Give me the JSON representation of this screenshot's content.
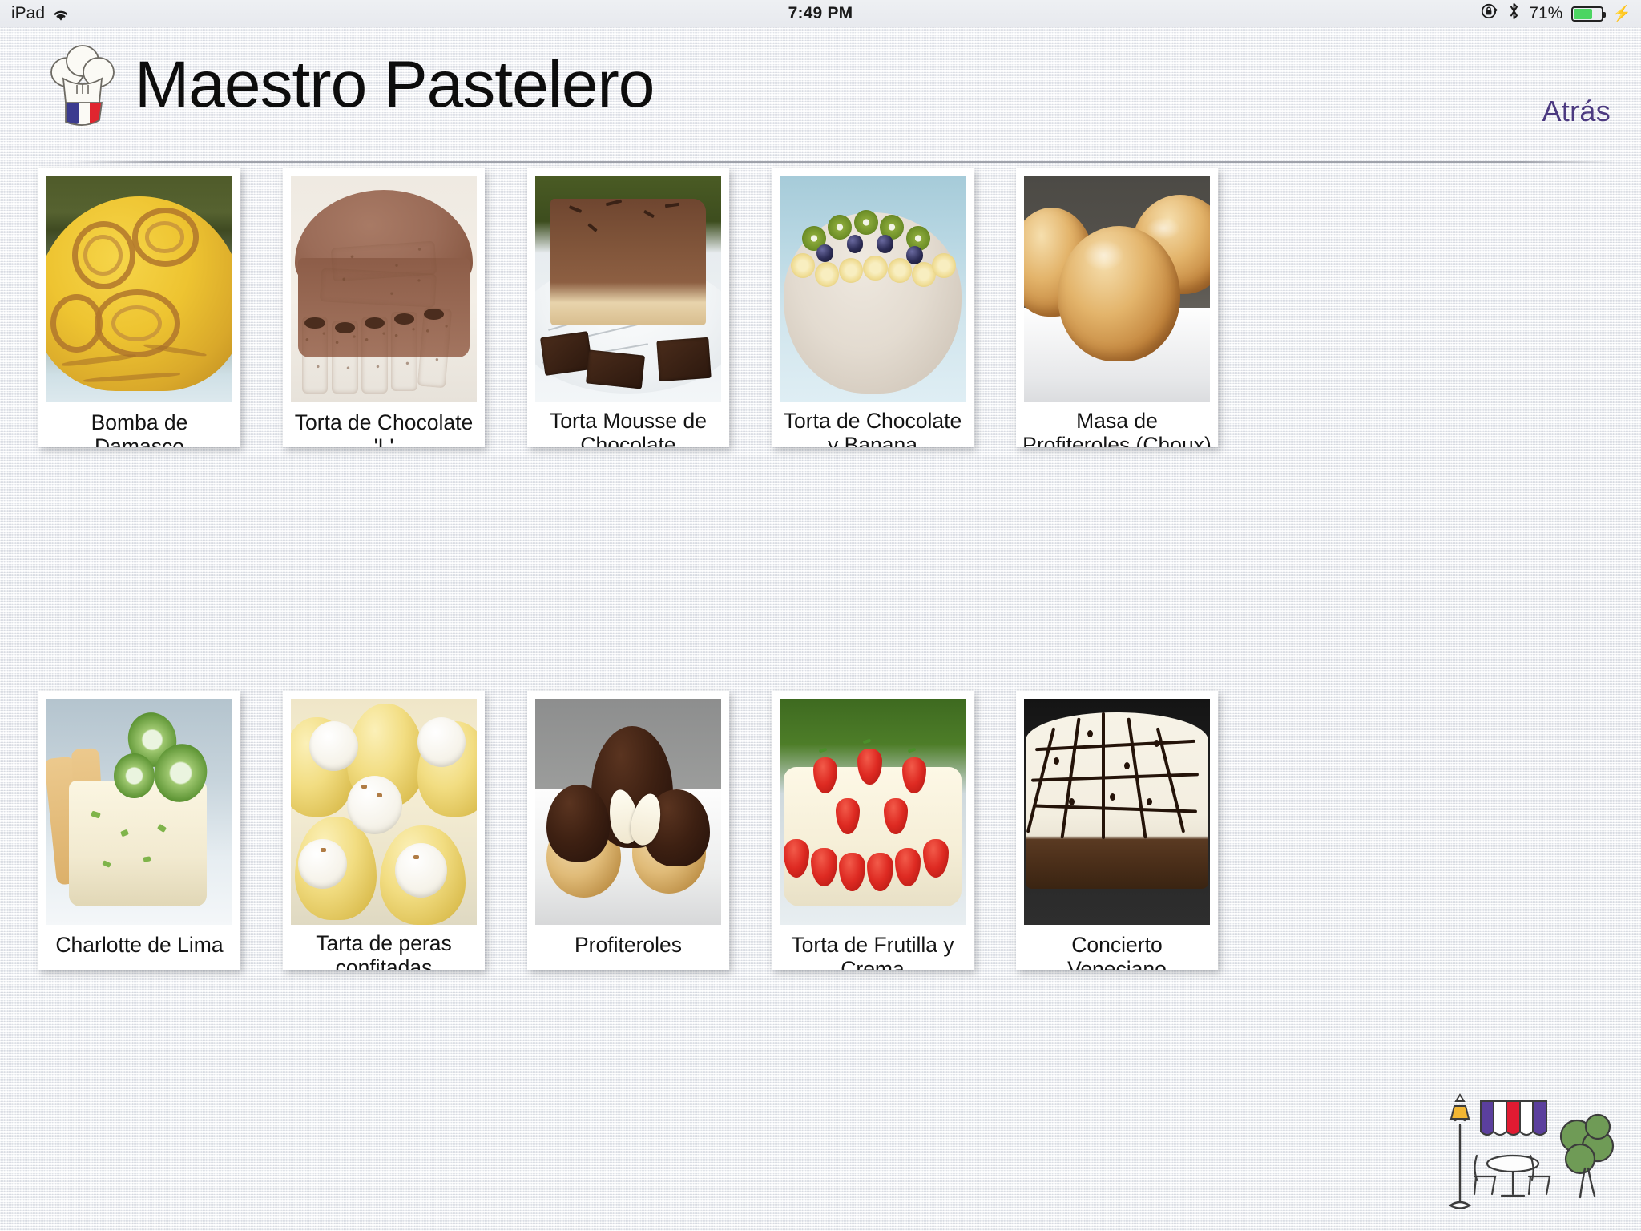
{
  "status_bar": {
    "device_label": "iPad",
    "wifi_icon": "wifi-icon",
    "time": "7:49 PM",
    "rotation_lock_icon": "rotation-lock-icon",
    "bluetooth_icon": "bluetooth-icon",
    "battery_percent": "71%",
    "battery_fill_color": "#4cd562",
    "charging_icon": "lightning-bolt-icon"
  },
  "header": {
    "logo_icon": "chef-hat-icon",
    "title": "Maestro Pastelero",
    "back_label": "Atrás",
    "back_color": "#4c3a80"
  },
  "grid": {
    "rows": [
      {
        "cards": [
          {
            "title": "Bomba de Damasco",
            "image_alt": "swiss-roll-slices-dome-cake",
            "lines": 1
          },
          {
            "title": "Torta de Chocolate 'L'",
            "image_alt": "chocolate-cake-with-wafer-rolls",
            "lines": 1
          },
          {
            "title": "Torta Mousse de Chocolate",
            "image_alt": "chocolate-mousse-tart-slice",
            "lines": 2
          },
          {
            "title": "Torta de Chocolate y Banana",
            "image_alt": "cake-with-kiwi-banana-blueberries",
            "lines": 2
          },
          {
            "title": "Masa de Profiteroles (Choux)",
            "image_alt": "golden-choux-puffs-in-dish",
            "lines": 2
          }
        ]
      },
      {
        "cards": [
          {
            "title": "Charlotte de Lima",
            "image_alt": "lime-charlotte-with-cucumber",
            "lines": 1
          },
          {
            "title": "Tarta de peras confitadas",
            "image_alt": "candied-pear-tart-with-cream",
            "lines": 2
          },
          {
            "title": "Profiteroles",
            "image_alt": "profiteroles-with-chocolate-sauce",
            "lines": 1
          },
          {
            "title": "Torta de Frutilla y Crema",
            "image_alt": "strawberry-cream-cake",
            "lines": 1
          },
          {
            "title": "Concierto Veneciano",
            "image_alt": "chocolate-lattice-cheesecake",
            "lines": 1
          }
        ]
      }
    ]
  },
  "footer": {
    "logo_icon": "french-cafe-sketch-logo",
    "awning_colors": [
      "#5b3f9d",
      "#ffffff",
      "#e01b32"
    ],
    "lamp_light_color": "#f2b632",
    "tree_color": "#6f9b56"
  }
}
